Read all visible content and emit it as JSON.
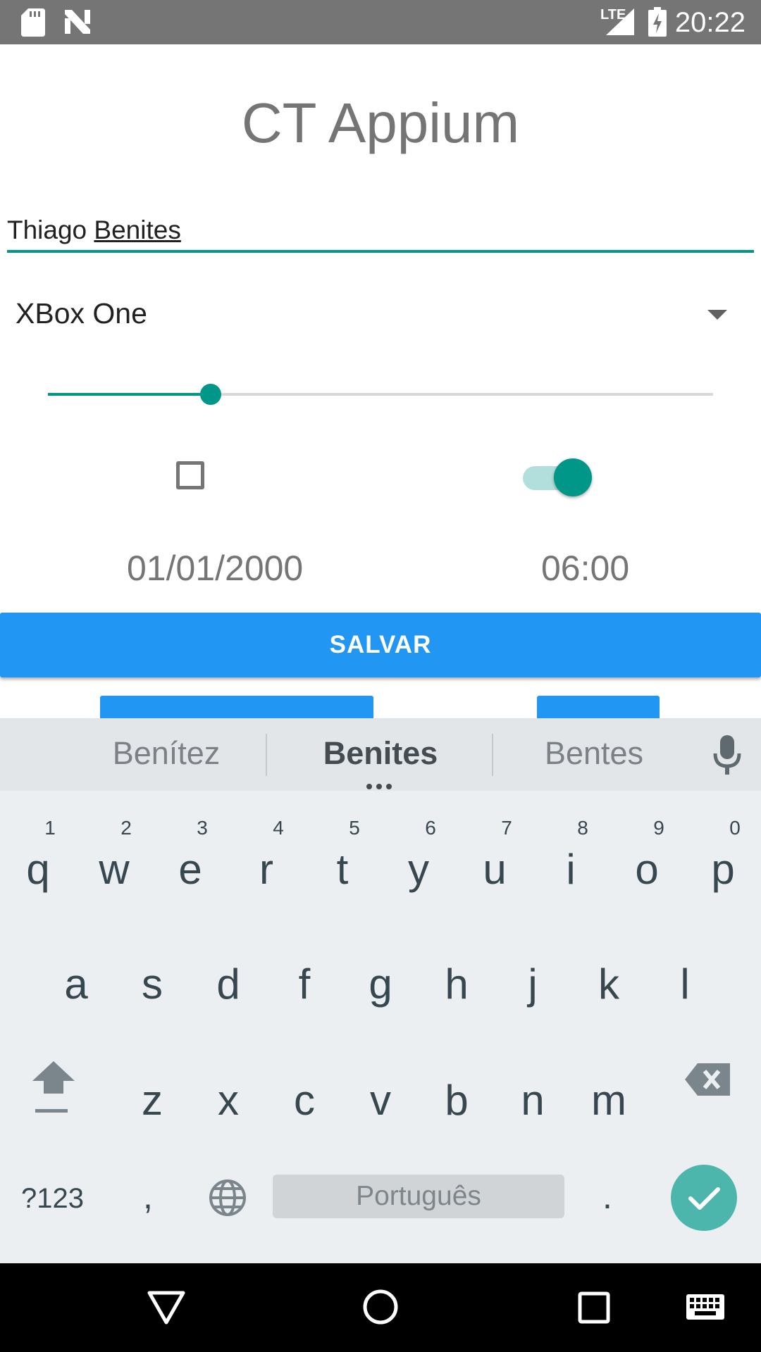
{
  "status_bar": {
    "time": "20:22",
    "network_label": "LTE",
    "icons": [
      "sd-card-icon",
      "n-logo-icon",
      "signal-icon",
      "battery-charging-icon"
    ]
  },
  "app": {
    "title": "CT Appium",
    "name_field": {
      "value_first": "Thiago ",
      "value_composing": "Benites"
    },
    "spinner": {
      "selected": "XBox One"
    },
    "slider": {
      "level": 0.245
    },
    "checkbox": {
      "checked": false
    },
    "switch": {
      "on": true
    },
    "date": "01/01/2000",
    "time": "06:00",
    "save_label": "SALVAR"
  },
  "keyboard": {
    "suggestions": [
      "Benítez",
      "Benites",
      "Bentes"
    ],
    "row1": [
      {
        "key": "q",
        "hint": "1"
      },
      {
        "key": "w",
        "hint": "2"
      },
      {
        "key": "e",
        "hint": "3"
      },
      {
        "key": "r",
        "hint": "4"
      },
      {
        "key": "t",
        "hint": "5"
      },
      {
        "key": "y",
        "hint": "6"
      },
      {
        "key": "u",
        "hint": "7"
      },
      {
        "key": "i",
        "hint": "8"
      },
      {
        "key": "o",
        "hint": "9"
      },
      {
        "key": "p",
        "hint": "0"
      }
    ],
    "row2": [
      "a",
      "s",
      "d",
      "f",
      "g",
      "h",
      "j",
      "k",
      "l"
    ],
    "row3": [
      "z",
      "x",
      "c",
      "v",
      "b",
      "n",
      "m"
    ],
    "symbols_label": "?123",
    "comma_label": ",",
    "space_label": "Português",
    "period_label": "."
  },
  "colors": {
    "accent": "#009688",
    "button": "#2196f3",
    "status_bar": "#757575",
    "keyboard_bg": "#eceff1",
    "enter_key": "#4db6ac"
  }
}
